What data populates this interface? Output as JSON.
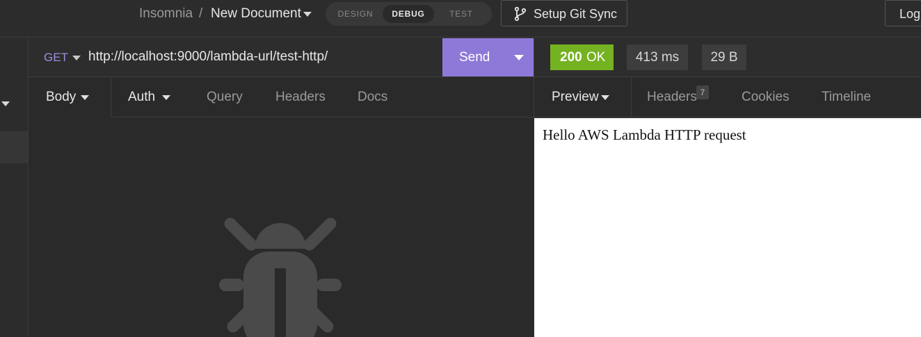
{
  "header": {
    "breadcrumb_app": "Insomnia",
    "breadcrumb_sep": "/",
    "breadcrumb_doc": "New Document",
    "modes": {
      "design": "DESIGN",
      "debug": "DEBUG",
      "test": "TEST"
    },
    "active_mode": "DEBUG",
    "git_sync_label": "Setup Git Sync",
    "login_label": "Log"
  },
  "request": {
    "method": "GET",
    "url": "http://localhost:9000/lambda-url/test-http/",
    "send_label": "Send",
    "tabs": {
      "body": "Body",
      "auth": "Auth",
      "query": "Query",
      "headers": "Headers",
      "docs": "Docs"
    }
  },
  "response": {
    "status_code": "200",
    "status_text": "OK",
    "time": "413 ms",
    "size": "29 B",
    "tabs": {
      "preview": "Preview",
      "headers": "Headers",
      "headers_count": "7",
      "cookies": "Cookies",
      "timeline": "Timeline"
    },
    "body_text": "Hello AWS Lambda HTTP request"
  },
  "colors": {
    "accent_purple": "#8e79d8",
    "method_purple": "#9b8fe0",
    "status_green": "#75b221",
    "background": "#2a2a2a"
  },
  "icons": {
    "git": "git-branch-icon",
    "empty_state": "bug-icon"
  }
}
